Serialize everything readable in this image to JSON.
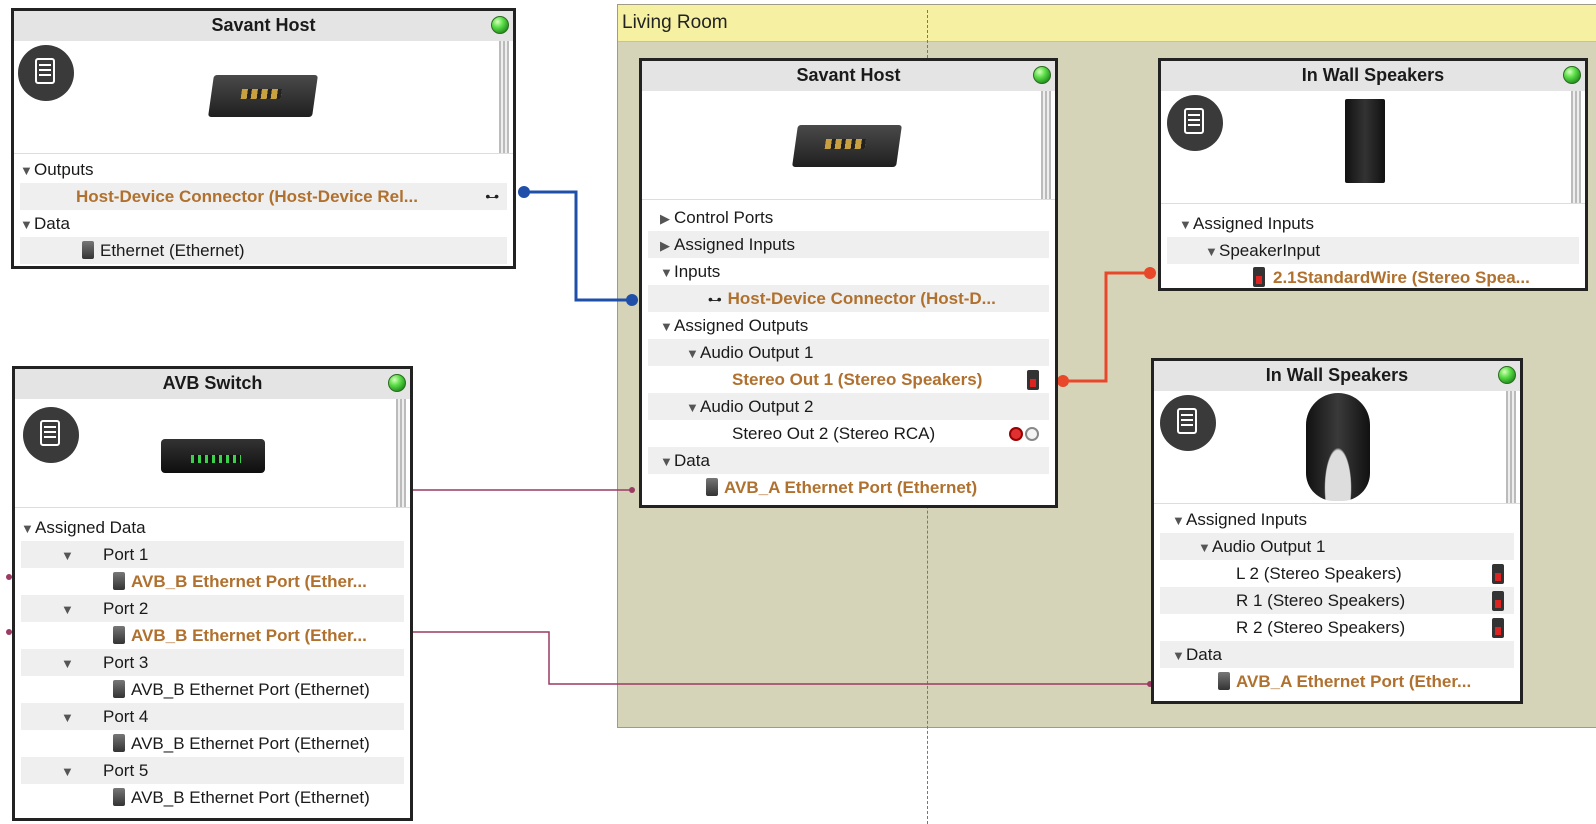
{
  "room": {
    "title": "Living Room"
  },
  "host_left": {
    "title": "Savant Host",
    "sections": [
      {
        "label": "Outputs"
      },
      {
        "label": "Data"
      }
    ],
    "output_connector": "Host-Device Connector  (Host-Device Rel...",
    "data_item": "Ethernet (Ethernet)"
  },
  "avb_switch": {
    "title": "AVB Switch",
    "assigned_data": "Assigned Data",
    "ports": [
      {
        "label": "Port 1",
        "item": "AVB_B Ethernet Port (Ether...",
        "connected": true
      },
      {
        "label": "Port 2",
        "item": "AVB_B Ethernet Port (Ether...",
        "connected": true
      },
      {
        "label": "Port 3",
        "item": "AVB_B Ethernet Port (Ethernet)",
        "connected": false
      },
      {
        "label": "Port 4",
        "item": "AVB_B Ethernet Port (Ethernet)",
        "connected": false
      },
      {
        "label": "Port 5",
        "item": "AVB_B Ethernet Port (Ethernet)",
        "connected": false
      }
    ]
  },
  "host_room": {
    "title": "Savant Host",
    "control_ports": "Control Ports",
    "assigned_inputs": "Assigned Inputs",
    "inputs": "Inputs",
    "input_connector": "Host-Device Connector  (Host-D...",
    "assigned_outputs": "Assigned Outputs",
    "audio_output_1": "Audio Output 1",
    "stereo_out_1": "Stereo Out 1 (Stereo Speakers)",
    "audio_output_2": "Audio Output 2",
    "stereo_out_2": "Stereo Out 2 (Stereo RCA)",
    "data": "Data",
    "data_item": "AVB_A Ethernet Port (Ethernet)"
  },
  "speakers_top": {
    "title": "In Wall Speakers",
    "assigned_inputs": "Assigned Inputs",
    "speaker_input": "SpeakerInput",
    "wire": "2.1StandardWire (Stereo Spea..."
  },
  "speakers_bottom": {
    "title": "In Wall Speakers",
    "assigned_inputs": "Assigned Inputs",
    "audio_output_1": "Audio Output 1",
    "items": [
      "L 2 (Stereo Speakers)",
      "R 1 (Stereo Speakers)",
      "R 2 (Stereo Speakers)"
    ],
    "data": "Data",
    "data_item": "AVB_A Ethernet Port (Ether..."
  },
  "colors": {
    "connected_text": "#b0712f",
    "wire_blue": "#1f4fa8",
    "wire_red": "#e8472a",
    "wire_ethernet": "#9b3a63",
    "room_bg": "#d6d4b8",
    "room_header": "#f5f0a2",
    "status_led": "#5fe04b"
  }
}
